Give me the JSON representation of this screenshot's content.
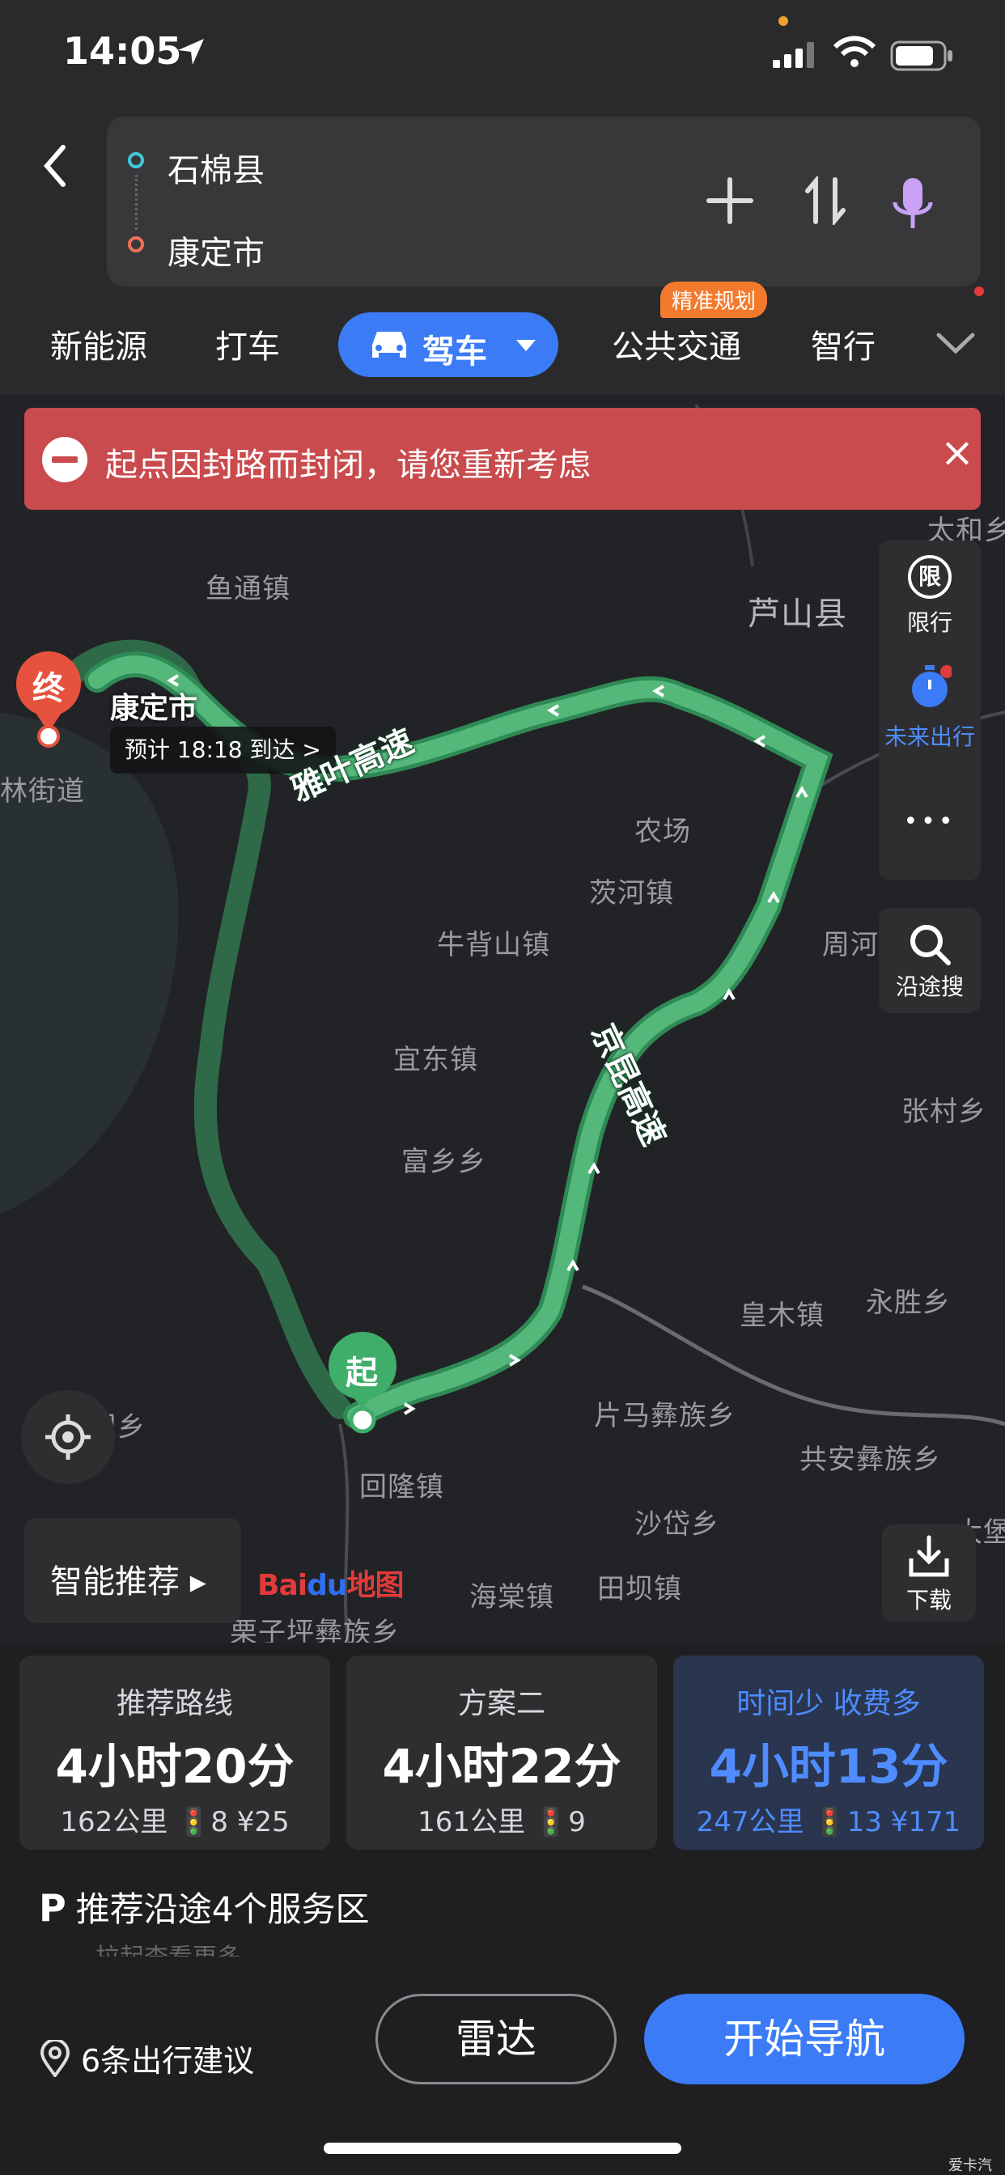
{
  "status_bar": {
    "time": "14:05"
  },
  "header": {
    "origin": "石棉县",
    "destination": "康定市",
    "tabs": [
      "新能源",
      "打车",
      "驾车",
      "公共交通",
      "智行"
    ],
    "active_tab": "驾车",
    "badge": "精准规划"
  },
  "alert": {
    "text": "起点因封路而封闭，请您重新考虑"
  },
  "map": {
    "places": [
      "鱼通镇",
      "芦山县",
      "林街道",
      "农场",
      "茨河镇",
      "牛背山镇",
      "周河",
      "宜东镇",
      "富乡乡",
      "张村乡",
      "皇木镇",
      "永胜乡",
      "片马彝族乡",
      "共安彝族乡",
      "沙岱乡",
      "回隆镇",
      "田坝镇",
      "海棠镇",
      "栗子坪彝族乡",
      "大堡",
      "太和乡",
      "坝乡"
    ],
    "dest_city": "康定市",
    "eta": "预计 18:18 到达 >",
    "end_marker": "终",
    "start_marker": "起",
    "road_1": "雅叶高速",
    "road_2": "京昆高速"
  },
  "side_tools": {
    "limit_icon": "限",
    "limit": "限行",
    "future": "未来出行",
    "more": "•••",
    "search_along": "沿途搜",
    "download": "下载"
  },
  "smart_recommend": "智能推荐 ▸",
  "logo": {
    "bai": "Bai",
    "du": "du",
    "map": "地图"
  },
  "routes": [
    {
      "title": "推荐路线",
      "duration": "4小时20分",
      "meta": "162公里 🚦8 ¥25",
      "selected": false
    },
    {
      "title": "方案二",
      "duration": "4小时22分",
      "meta": "161公里 🚦9",
      "selected": false
    },
    {
      "title": "时间少 收费多",
      "duration": "4小时13分",
      "meta": "247公里 🚦13 ¥171",
      "selected": true
    }
  ],
  "service_area": {
    "text": "推荐沿途4个服务区",
    "sub": "拉起查看更多"
  },
  "bottom": {
    "suggestions": "6条出行建议",
    "radar": "雷达",
    "navigate": "开始导航"
  },
  "watermark": "爱卡汽车",
  "colors": {
    "accent": "#3b7cf6",
    "route": "#4caf6f",
    "alert": "#c94b4d",
    "badge": "#f37a2c"
  }
}
